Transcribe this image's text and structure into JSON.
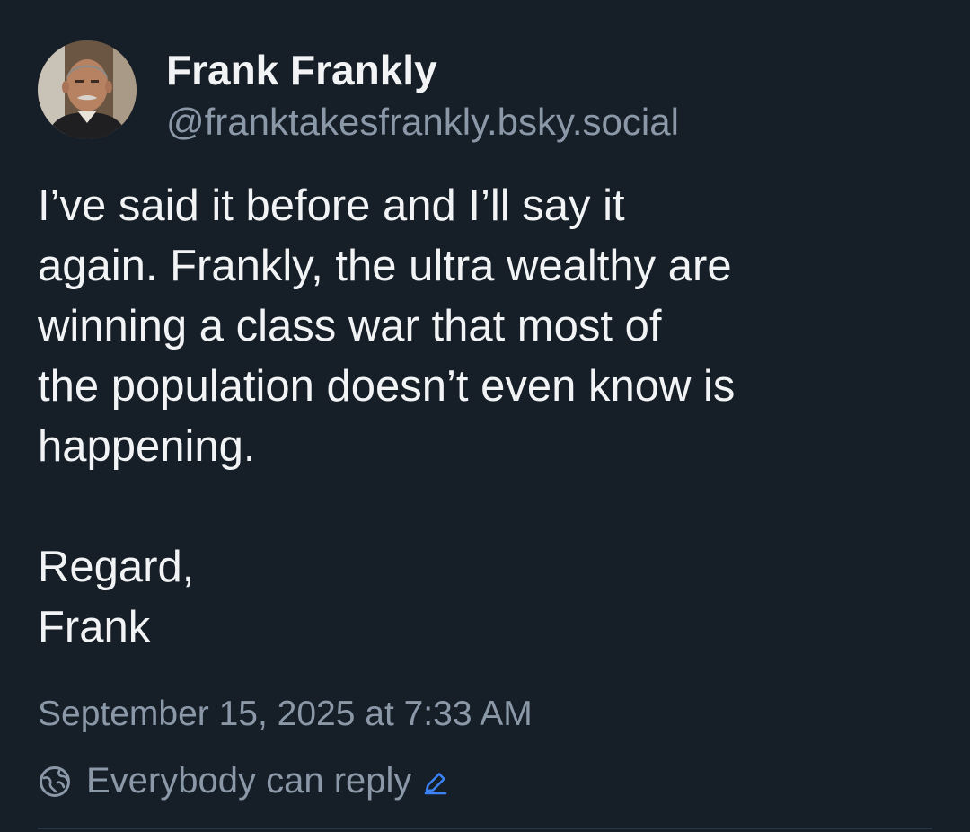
{
  "author": {
    "display_name": "Frank Frankly",
    "handle": "@franktakesfrankly.bsky.social",
    "avatar_icon": "avatar-photo"
  },
  "post": {
    "lines": [
      "I’ve said it before and I’ll say it",
      "again. Frankly, the ultra wealthy are",
      "winning a class war that most of",
      "the population doesn’t even know is",
      "happening."
    ],
    "signoff": [
      "Regard,",
      "Frank"
    ],
    "timestamp": "September 15, 2025 at 7:33 AM"
  },
  "reply_settings": {
    "label": "Everybody can reply",
    "icon": "globe-icon",
    "edit_icon": "pencil-icon"
  },
  "colors": {
    "background": "#161e27",
    "text_primary": "#f1f3f5",
    "text_secondary": "#8b98a8",
    "accent": "#3b82f6"
  }
}
